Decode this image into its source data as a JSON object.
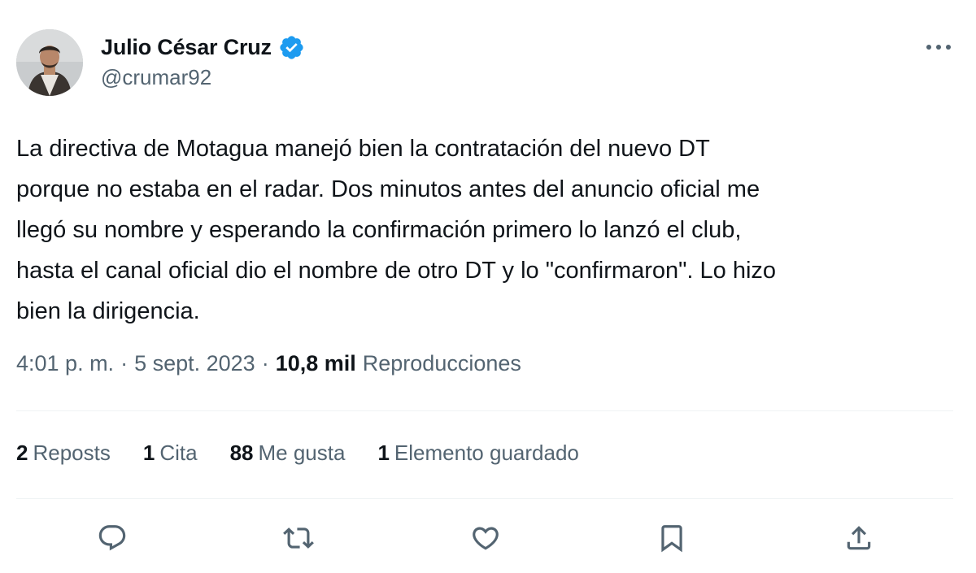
{
  "author": {
    "display_name": "Julio César Cruz",
    "handle": "@crumar92",
    "verified": true
  },
  "tweet": {
    "lines": [
      "La directiva de Motagua manejó bien la contratación del nuevo DT",
      "porque no estaba en el radar. Dos minutos antes del anuncio oficial me",
      "llegó su nombre y esperando la confirmación primero lo lanzó el club,",
      "hasta el canal oficial dio el nombre de otro DT y lo \"confirmaron\". Lo hizo",
      "bien la dirigencia."
    ]
  },
  "meta": {
    "time": "4:01 p. m.",
    "separator": "·",
    "date": "5 sept. 2023",
    "views_count": "10,8 mil",
    "views_label": "Reproducciones"
  },
  "stats": {
    "reposts": {
      "count": "2",
      "label": "Reposts"
    },
    "quotes": {
      "count": "1",
      "label": "Cita"
    },
    "likes": {
      "count": "88",
      "label": "Me gusta"
    },
    "bookmarks": {
      "count": "1",
      "label": "Elemento guardado"
    }
  },
  "icons": {
    "more": "more-icon",
    "reply": "reply-icon",
    "repost": "repost-icon",
    "like": "like-icon",
    "bookmark": "bookmark-icon",
    "share": "share-icon",
    "verified": "verified-badge-icon"
  },
  "colors": {
    "text_primary": "#0f1419",
    "text_secondary": "#536471",
    "verified_blue": "#1d9bf0",
    "divider": "#eff3f4"
  }
}
